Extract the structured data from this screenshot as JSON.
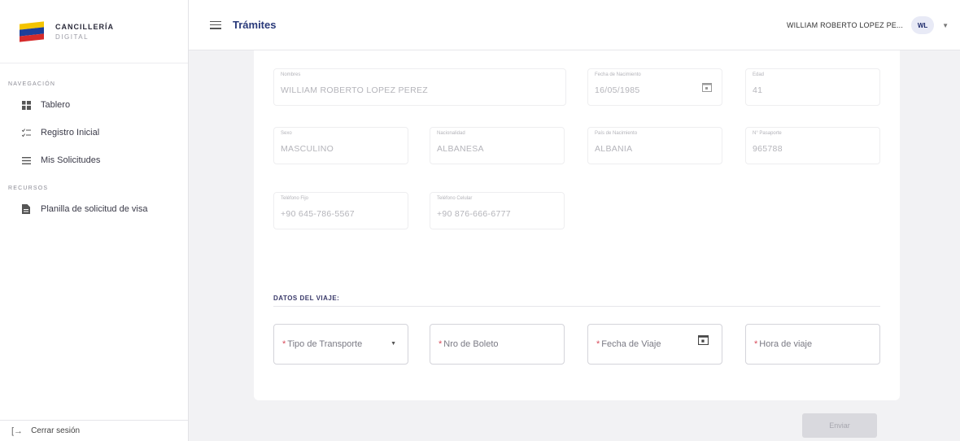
{
  "brand": {
    "title": "CANCILLERÍA",
    "subtitle": "DIGITAL"
  },
  "sidebar": {
    "section_nav": "NAVEGACIÓN",
    "nav_items": [
      "Tablero",
      "Registro Inicial",
      "Mis Solicitudes"
    ],
    "section_rec": "RECURSOS",
    "rec_items": [
      "Planilla de solicitud de visa"
    ],
    "logout": "Cerrar sesión"
  },
  "header": {
    "title": "Trámites",
    "user_name": "WILLIAM ROBERTO LOPEZ PE...",
    "avatar": "WL"
  },
  "personal": {
    "nombres": {
      "label": "Nombres",
      "value": "WILLIAM ROBERTO LOPEZ PEREZ"
    },
    "fecha_nacimiento": {
      "label": "Fecha de Nacimiento",
      "value": "16/05/1985"
    },
    "edad": {
      "label": "Edad",
      "value": "41"
    },
    "sexo": {
      "label": "Sexo",
      "value": "MASCULINO"
    },
    "nacionalidad": {
      "label": "Nacionalidad",
      "value": "ALBANESA"
    },
    "pais_nacimiento": {
      "label": "País de Nacimiento",
      "value": "ALBANIA"
    },
    "pasaporte": {
      "label": "N° Pasaporte",
      "value": "965788"
    },
    "telefono_fijo": {
      "label": "Teléfono Fijo",
      "value": "+90 645-786-5567"
    },
    "telefono_celular": {
      "label": "Teléfono Celular",
      "value": "+90 876-666-6777"
    }
  },
  "viaje": {
    "section_title": "DATOS DEL VIAJE:",
    "req_mark": "*",
    "tipo_transporte": "Tipo de Transporte",
    "nro_boleto": "Nro de Boleto",
    "fecha_viaje": "Fecha de Viaje",
    "hora_viaje": "Hora de viaje"
  },
  "actions": {
    "send": "Enviar"
  },
  "colors": {
    "accent": "#2a3a7a",
    "required": "#d84c5c"
  }
}
